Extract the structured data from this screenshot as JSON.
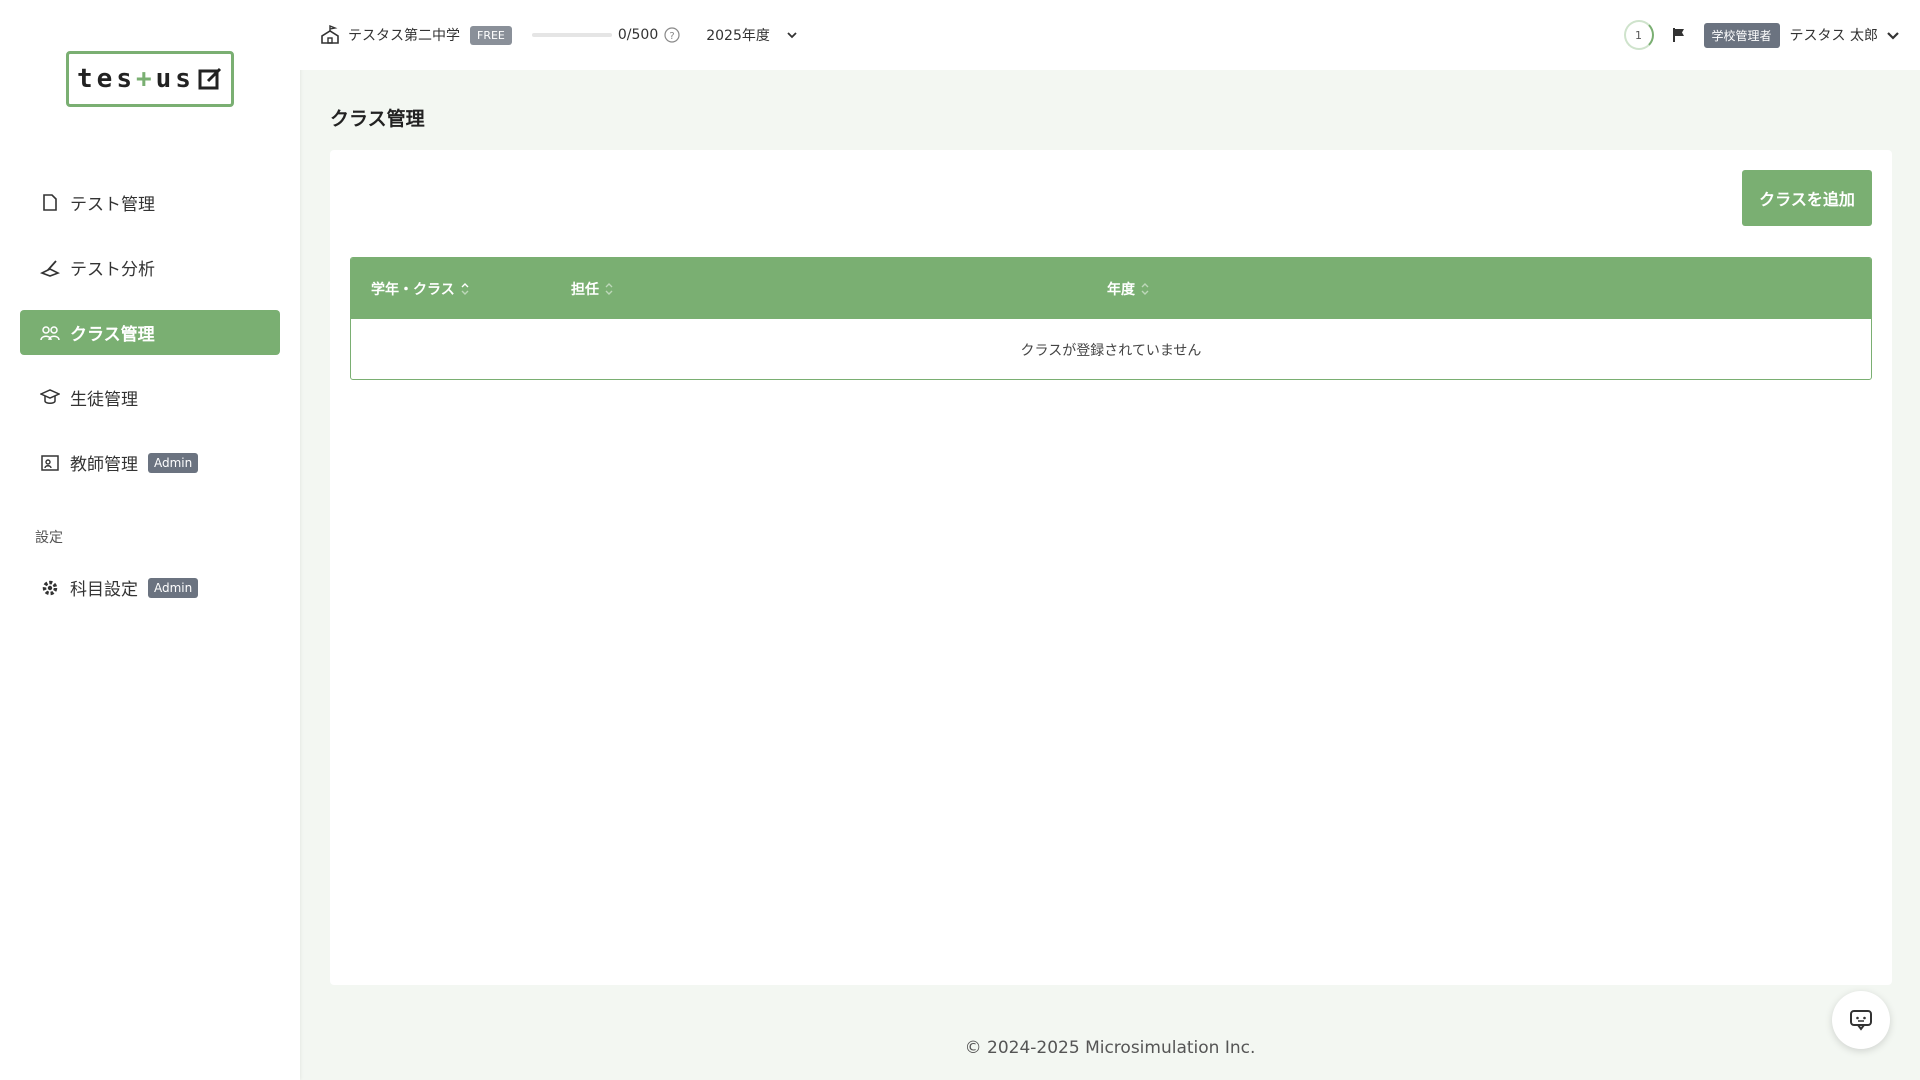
{
  "logo": {
    "text_before": "tes",
    "plus": "+",
    "text_after": "us"
  },
  "sidebar": {
    "items": [
      {
        "label": "テスト管理",
        "icon": "document-icon"
      },
      {
        "label": "テスト分析",
        "icon": "analysis-icon"
      },
      {
        "label": "クラス管理",
        "icon": "group-icon",
        "active": true
      },
      {
        "label": "生徒管理",
        "icon": "graduation-cap-icon"
      },
      {
        "label": "教師管理",
        "icon": "teacher-board-icon",
        "badge": "Admin"
      }
    ],
    "settings_heading": "設定",
    "settings_items": [
      {
        "label": "科目設定",
        "icon": "gear-icon",
        "badge": "Admin"
      }
    ]
  },
  "header": {
    "school_name": "テスタス第二中学",
    "plan_badge": "FREE",
    "usage_text": "0/500",
    "usage_fraction": 0,
    "year": "2025年度",
    "notification_count": "1",
    "role_badge": "学校管理者",
    "user_name": "テスタス 太郎"
  },
  "main": {
    "page_title": "クラス管理",
    "add_button_label": "クラスを追加",
    "table": {
      "columns": [
        "学年・クラス",
        "担任",
        "年度"
      ],
      "empty_message": "クラスが登録されていません"
    }
  },
  "footer": {
    "copyright": "© 2024-2025 Microsimulation Inc."
  },
  "colors": {
    "accent": "#7aaf72",
    "badge_gray": "#6b7380",
    "background": "#f3f7f2"
  }
}
